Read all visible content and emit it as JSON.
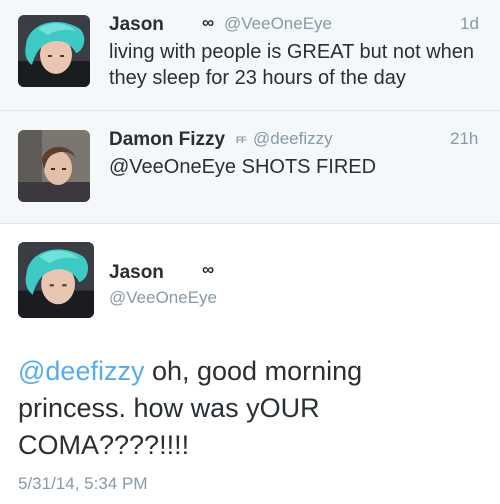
{
  "timeline": [
    {
      "name": "Jason",
      "badge": "∞",
      "handle": "@VeeOneEye",
      "time": "1d",
      "text_line1": "living with people is GREAT but not when",
      "text_line2": "they sleep for 23 hours of the day"
    },
    {
      "name": "Damon Fizzy",
      "badge": "FF",
      "handle": "@deefizzy",
      "time": "21h",
      "text_line1": "@VeeOneEye SHOTS FIRED"
    }
  ],
  "detail": {
    "name": "Jason",
    "badge": "∞",
    "handle": "@VeeOneEye",
    "mention": "@deefizzy",
    "text_rest_1": " oh, good morning",
    "text_line2": "princess. how was yOUR",
    "text_line3": "COMA????!!!!",
    "timestamp": "5/31/14, 5:34 PM"
  },
  "colors": {
    "accent": "#55acee",
    "muted": "#8899a6",
    "text": "#292f33",
    "row_bg": "#f5f8fa",
    "hair_teal": "#3ec9c4"
  }
}
